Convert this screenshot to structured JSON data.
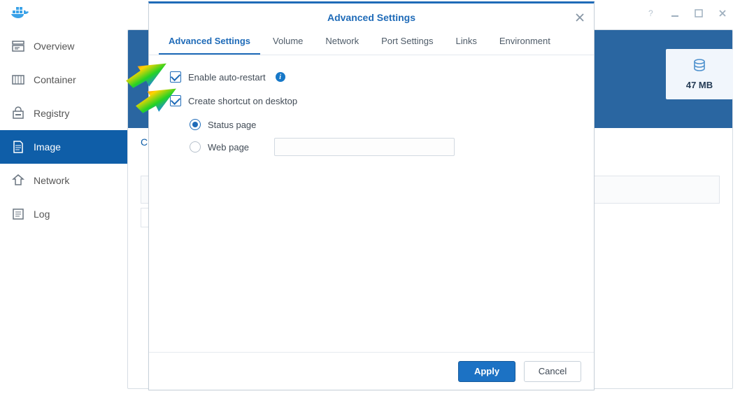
{
  "sidebar": {
    "items": [
      {
        "label": "Overview"
      },
      {
        "label": "Container"
      },
      {
        "label": "Registry"
      },
      {
        "label": "Image"
      },
      {
        "label": "Network"
      },
      {
        "label": "Log"
      }
    ]
  },
  "tile": {
    "size": "47 MB"
  },
  "content": {
    "fragment_char": "C"
  },
  "dialog": {
    "title": "Advanced Settings",
    "tabs": [
      "Advanced Settings",
      "Volume",
      "Network",
      "Port Settings",
      "Links",
      "Environment"
    ],
    "enable_auto_restart": "Enable auto-restart",
    "create_shortcut": "Create shortcut on desktop",
    "status_page": "Status page",
    "web_page": "Web page",
    "info_badge": "i",
    "apply": "Apply",
    "cancel": "Cancel"
  }
}
